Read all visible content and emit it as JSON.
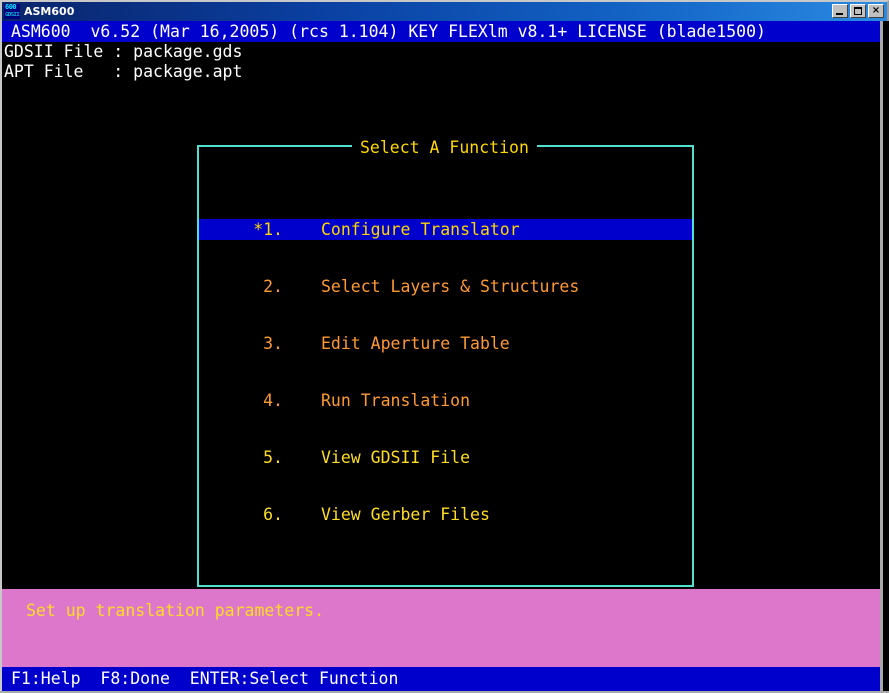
{
  "window": {
    "title": "ASM600",
    "icon_name": "asm600-app-icon",
    "icon_top_text": "600",
    "icon_bottom_text": "GDSII",
    "buttons": {
      "minimize": "_",
      "maximize": "□",
      "close": "×"
    }
  },
  "header": {
    "version_line": "ASM600  v6.52 (Mar 16,2005) (rcs 1.104) KEY FLEXlm v8.1+ LICENSE (blade1500)",
    "background_color": "#0000cc",
    "text_color": "#ffffff"
  },
  "files": {
    "gdsii_line": "GDSII File : package.gds",
    "apt_line": "APT File   : package.apt",
    "gdsii_label": "GDSII File",
    "gdsii_value": "package.gds",
    "apt_label": "APT File",
    "apt_value": "package.apt"
  },
  "menu": {
    "title": "Select A Function",
    "border_color": "#4fe0d0",
    "title_color": "#ffd700",
    "selected_bg": "#0000cc",
    "selected_fg": "#ffd700",
    "items": [
      {
        "num": "*1.",
        "label": "Configure Translator",
        "selected": true,
        "color": "#ffd700"
      },
      {
        "num": "2.",
        "label": "Select Layers & Structures",
        "selected": false,
        "color": "#ff9933"
      },
      {
        "num": "3.",
        "label": "Edit Aperture Table",
        "selected": false,
        "color": "#ff9933"
      },
      {
        "num": "4.",
        "label": "Run Translation",
        "selected": false,
        "color": "#ff9933"
      },
      {
        "num": "5.",
        "label": "View GDSII File",
        "selected": false,
        "color": "#ffdd22"
      },
      {
        "num": "6.",
        "label": "View Gerber Files",
        "selected": false,
        "color": "#ffdd22"
      }
    ]
  },
  "hint": {
    "text": "Set up translation parameters.",
    "background_color": "#dd77cc",
    "text_color": "#ffdd22"
  },
  "keybar": {
    "text": "F1:Help  F8:Done  ENTER:Select Function",
    "keys": [
      {
        "key": "F1",
        "action": "Help"
      },
      {
        "key": "F8",
        "action": "Done"
      },
      {
        "key": "ENTER",
        "action": "Select Function"
      }
    ],
    "background_color": "#0000cc",
    "text_color": "#ffffff"
  }
}
